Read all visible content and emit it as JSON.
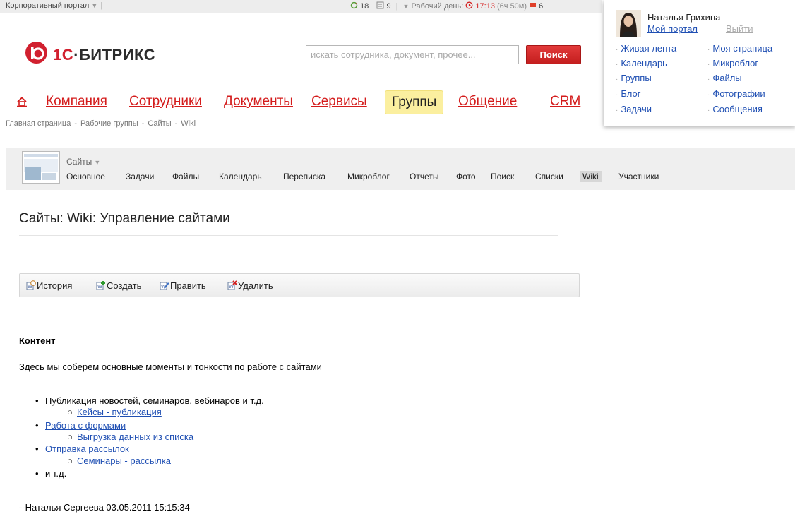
{
  "topbar": {
    "portal_label": "Корпоративный портал",
    "counter_a": "18",
    "counter_b": "9",
    "workday_label": "Рабочий день:",
    "time": "17:13",
    "duration": "(6ч 50м)",
    "flag_count": "6"
  },
  "logo": {
    "one": "1С",
    "rest": "·БИТРИКС"
  },
  "search": {
    "placeholder": "искать сотрудника, документ, прочее...",
    "button_label": "Поиск"
  },
  "mainmenu": {
    "items": [
      {
        "label": "Компания"
      },
      {
        "label": "Сотрудники"
      },
      {
        "label": "Документы"
      },
      {
        "label": "Сервисы"
      },
      {
        "label": "Группы",
        "active": true
      },
      {
        "label": "Общение"
      },
      {
        "label": "CRM"
      }
    ]
  },
  "breadcrumb": [
    "Главная страница",
    "Рабочие группы",
    "Сайты",
    "Wiki"
  ],
  "user": {
    "name": "Наталья Грихина",
    "my_portal": "Мой портал",
    "logout": "Выйти",
    "links_left": [
      "Живая лента",
      "Календарь",
      "Группы",
      "Блог",
      "Задачи"
    ],
    "links_right": [
      "Моя страница",
      "Микроблог",
      "Файлы",
      "Фотографии",
      "Сообщения"
    ]
  },
  "group": {
    "name": "Сайты",
    "tabs": [
      "Основное",
      "Задачи",
      "Файлы",
      "Календарь",
      "Переписка",
      "Микроблог",
      "Отчеты",
      "Фото",
      "Поиск",
      "Списки",
      "Wiki",
      "Участники"
    ],
    "active_tab": "Wiki"
  },
  "page": {
    "title": "Сайты: Wiki: Управление сайтами"
  },
  "wiki_toolbar": {
    "history": "История",
    "create": "Создать",
    "edit": "Править",
    "delete": "Удалить"
  },
  "content": {
    "heading": "Контент",
    "intro": "Здесь мы соберем основные моменты и тонкости по работе с сайтами",
    "items": [
      {
        "text": "Публикация новостей, семинаров, вебинаров и т.д.",
        "link": false,
        "sub": "Кейсы - публикация"
      },
      {
        "text": "Работа с формами",
        "link": true,
        "sub": "Выгрузка данных из списка"
      },
      {
        "text": "Отправка рассылок",
        "link": true,
        "sub": "Семинары - рассылка"
      },
      {
        "text": "и т.д.",
        "link": false,
        "sub": null
      }
    ],
    "signature": "--Наталья Сергеева 03.05.2011 15:15:34"
  },
  "colors": {
    "accent_red": "#d41c1c",
    "link_blue": "#1f4fb3",
    "active_tab_bg": "#fbef9f"
  },
  "icons": [
    "home-icon",
    "history-icon",
    "create-icon",
    "edit-icon",
    "delete-icon",
    "clock-icon",
    "flag-icon"
  ]
}
